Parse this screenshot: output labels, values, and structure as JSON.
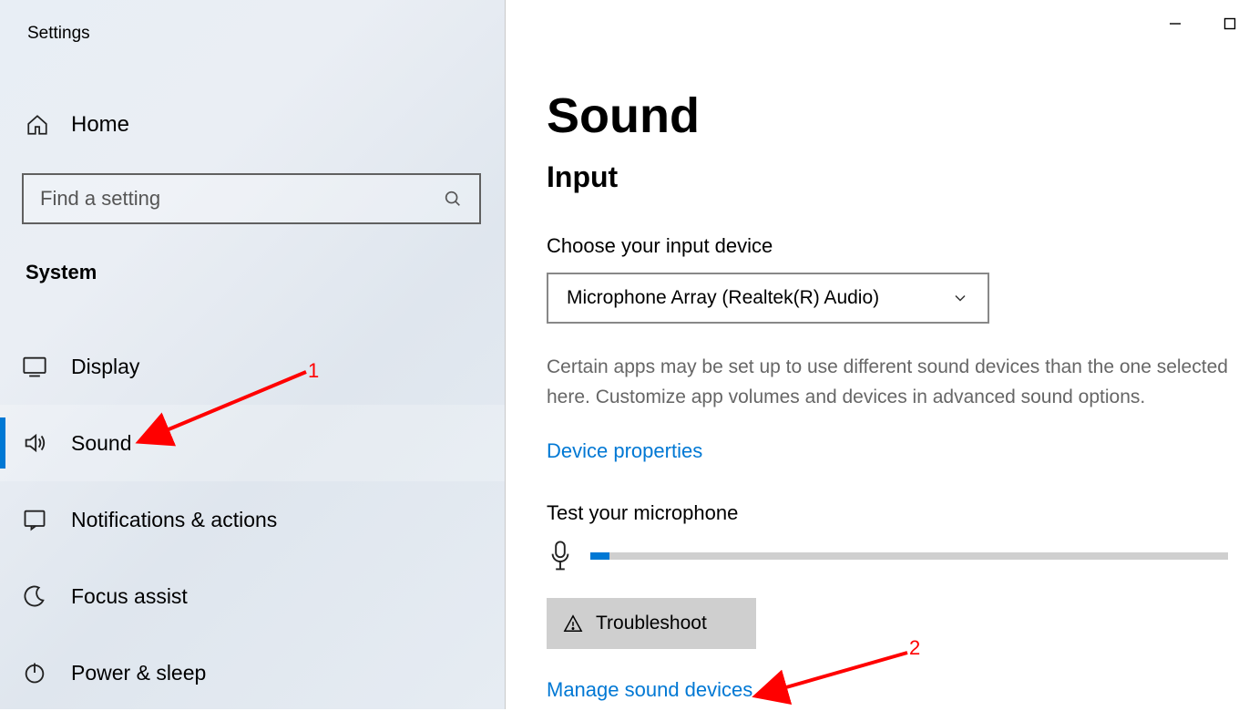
{
  "window": {
    "app_title": "Settings"
  },
  "sidebar": {
    "home_label": "Home",
    "search_placeholder": "Find a setting",
    "section_label": "System",
    "items": [
      {
        "label": "Display",
        "icon": "display-icon"
      },
      {
        "label": "Sound",
        "icon": "sound-icon",
        "active": true
      },
      {
        "label": "Notifications & actions",
        "icon": "notifications-icon"
      },
      {
        "label": "Focus assist",
        "icon": "moon-icon"
      },
      {
        "label": "Power & sleep",
        "icon": "power-icon"
      }
    ]
  },
  "main": {
    "page_title": "Sound",
    "section_title": "Input",
    "input_device_label": "Choose your input device",
    "input_device_value": "Microphone Array (Realtek(R) Audio)",
    "description": "Certain apps may be set up to use different sound devices than the one selected here. Customize app volumes and devices in advanced sound options.",
    "device_properties_link": "Device properties",
    "test_mic_label": "Test your microphone",
    "mic_level_percent": 3,
    "troubleshoot_label": "Troubleshoot",
    "manage_devices_link": "Manage sound devices"
  },
  "annotations": {
    "a1": "1",
    "a2": "2"
  }
}
